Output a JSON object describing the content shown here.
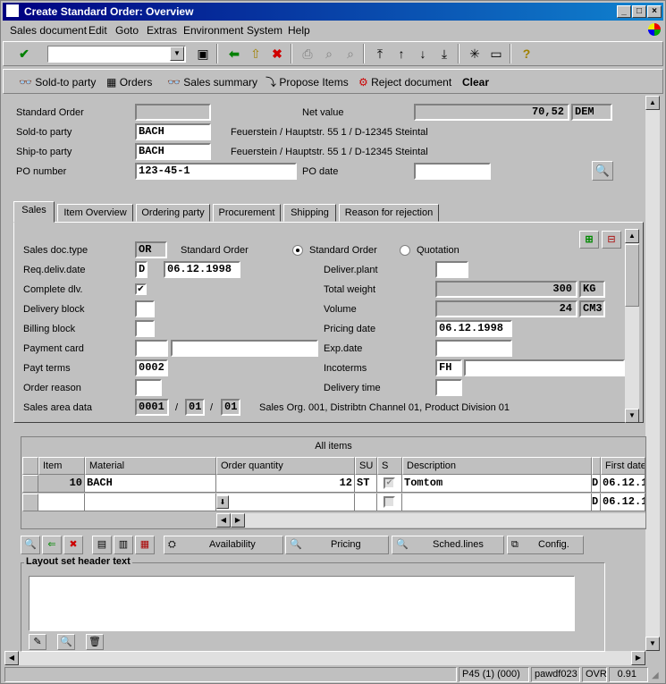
{
  "window": {
    "title": "Create Standard Order: Overview"
  },
  "menu": [
    "Sales document",
    "Edit",
    "Goto",
    "Extras",
    "Environment",
    "System",
    "Help"
  ],
  "appbar": {
    "sold_to": "Sold-to party",
    "orders": "Orders",
    "sales_summary": "Sales summary",
    "propose_items": "Propose Items",
    "reject_document": "Reject document",
    "clear": "Clear"
  },
  "header": {
    "standard_order_label": "Standard Order",
    "standard_order_value": "",
    "net_value_label": "Net value",
    "net_value": "70,52",
    "currency": "DEM",
    "sold_to_label": "Sold-to party",
    "sold_to_value": "BACH",
    "sold_to_address": "Feuerstein / Hauptstr. 55 1 / D-12345 Steintal",
    "ship_to_label": "Ship-to party",
    "ship_to_value": "BACH",
    "ship_to_address": "Feuerstein / Hauptstr. 55 1 / D-12345 Steintal",
    "po_number_label": "PO number",
    "po_number_value": "123-45-1",
    "po_date_label": "PO date",
    "po_date_value": ""
  },
  "tabs": [
    "Sales",
    "Item Overview",
    "Ordering party",
    "Procurement",
    "Shipping",
    "Reason for rejection"
  ],
  "sales": {
    "doc_type_label": "Sales doc.type",
    "doc_type_value": "OR",
    "doc_type_text": "Standard Order",
    "radio_standard": "Standard Order",
    "radio_quotation": "Quotation",
    "req_deliv_label": "Req.deliv.date",
    "req_deliv_type": "D",
    "req_deliv_value": "06.12.1998",
    "deliver_plant_label": "Deliver.plant",
    "deliver_plant_value": "",
    "complete_dlv_label": "Complete dlv.",
    "total_weight_label": "Total weight",
    "total_weight_value": "300",
    "total_weight_unit": "KG",
    "delivery_block_label": "Delivery block",
    "volume_label": "Volume",
    "volume_value": "24",
    "volume_unit": "CM3",
    "billing_block_label": "Billing block",
    "pricing_date_label": "Pricing date",
    "pricing_date_value": "06.12.1998",
    "payment_card_label": "Payment card",
    "exp_date_label": "Exp.date",
    "payt_terms_label": "Payt terms",
    "payt_terms_value": "0002",
    "incoterms_label": "Incoterms",
    "incoterms_value": "FH",
    "order_reason_label": "Order reason",
    "delivery_time_label": "Delivery time",
    "sales_area_label": "Sales area data",
    "sales_org": "0001",
    "distr_channel": "01",
    "division": "01",
    "sales_area_text": "Sales Org. 001, Distribtn Channel 01, Product Division 01"
  },
  "items": {
    "title": "All items",
    "columns": [
      "Item",
      "Material",
      "Order quantity",
      "SU",
      "S",
      "Description",
      "First date"
    ],
    "rows": [
      {
        "item": "10",
        "material": "BACH",
        "qty": "12",
        "su": "ST",
        "desc": "Tomtom",
        "d": "D",
        "date": "06.12.1"
      },
      {
        "item": "",
        "material": "",
        "qty": "",
        "su": "",
        "desc": "",
        "d": "D",
        "date": "06.12.1"
      }
    ]
  },
  "item_buttons": {
    "availability": "Availability",
    "pricing": "Pricing",
    "sched_lines": "Sched.lines",
    "config": "Config."
  },
  "layout_text": {
    "label": "Layout set header text"
  },
  "statusbar": {
    "system": "P45 (1) (000)",
    "server": "pawdf023",
    "mode": "OVR",
    "time": "0.91"
  }
}
